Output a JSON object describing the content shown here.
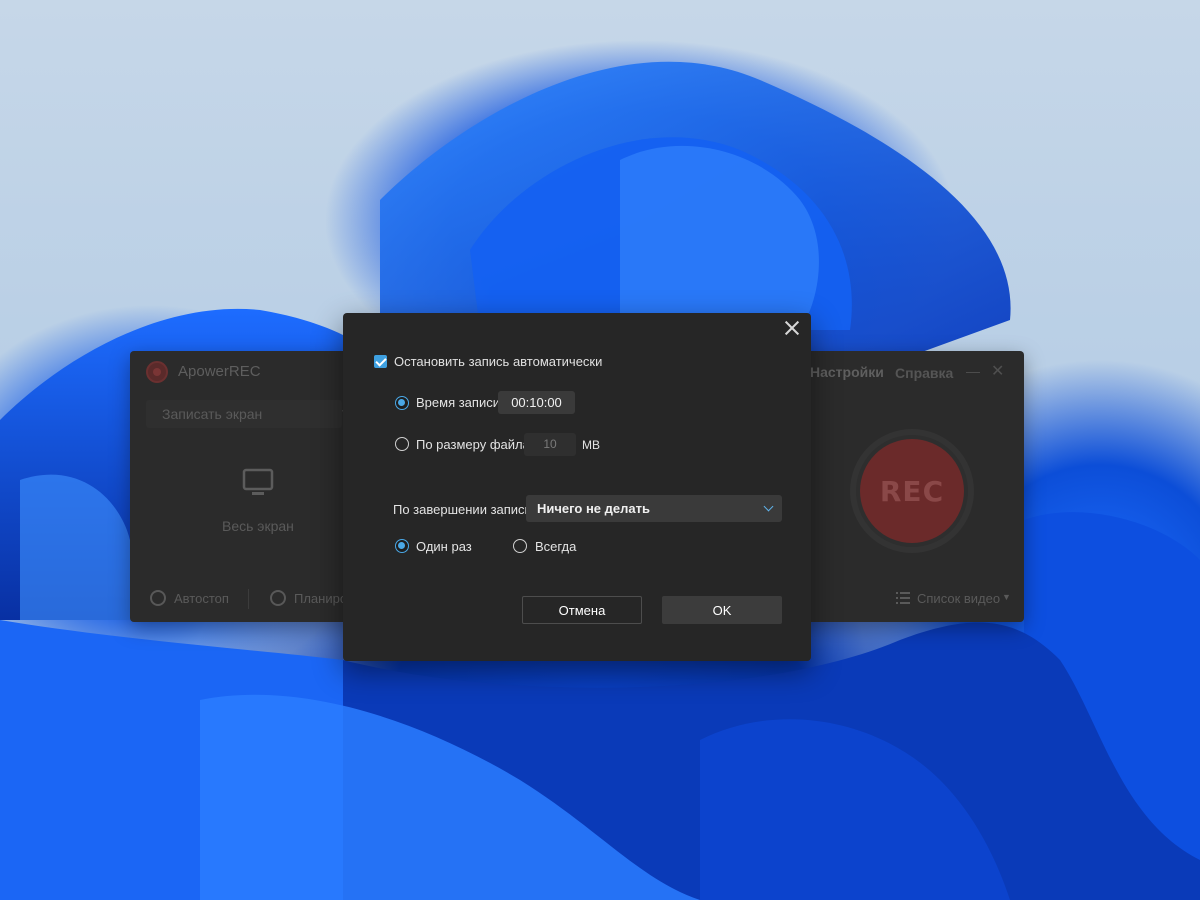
{
  "main_window": {
    "title": "ApowerREC",
    "record_mode": "Записать экран",
    "capture_area": "Весь экран",
    "menu_settings": "Настройки",
    "menu_help": "Справка",
    "rec_label": "REC",
    "footer_autostop": "Автостоп",
    "footer_schedule": "Планиро",
    "footer_video_list": "Список видео"
  },
  "dialog": {
    "checkbox_label": "Остановить запись автоматически",
    "checkbox_checked": true,
    "by_time_label": "Время записи",
    "time_value": "00:10:00",
    "by_size_label": "По размеру файла",
    "size_value": "10",
    "size_unit": "MB",
    "after_label": "По завершении записи",
    "after_action": "Ничего не делать",
    "once_label": "Один раз",
    "always_label": "Всегда",
    "cancel_label": "Отмена",
    "ok_label": "OK",
    "selected_mode": "by_time",
    "selected_repeat": "once"
  },
  "colors": {
    "accent": "#4aa8e6",
    "dialog_bg": "#262626",
    "rec_red": "#6b2a2a"
  }
}
